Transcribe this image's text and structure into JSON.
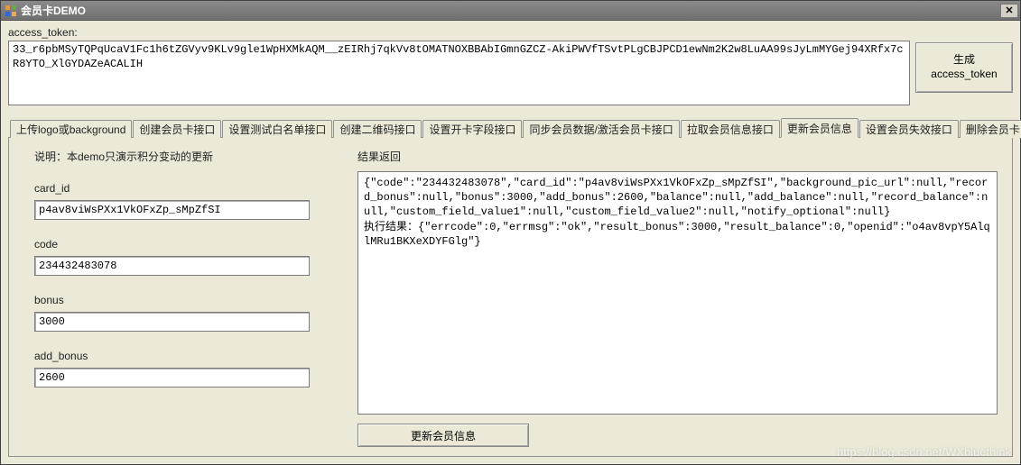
{
  "window": {
    "title": "会员卡DEMO"
  },
  "token": {
    "label": "access_token:",
    "value": "33_r6pbMSyTQPqUcaV1Fc1h6tZGVyv9KLv9gle1WpHXMkAQM__zEIRhj7qkVv8tOMATNOXBBAbIGmnGZCZ-AkiPWVfTSvtPLgCBJPCD1ewNm2K2w8LuAA99sJyLmMYGej94XRfx7cR8YTO_XlGYDAZeACALIH",
    "generate_label": "生成\naccess_token"
  },
  "tabs": {
    "items": [
      {
        "label": "上传logo或background"
      },
      {
        "label": "创建会员卡接口"
      },
      {
        "label": "设置测试白名单接口"
      },
      {
        "label": "创建二维码接口"
      },
      {
        "label": "设置开卡字段接口"
      },
      {
        "label": "同步会员数据/激活会员卡接口"
      },
      {
        "label": "拉取会员信息接口"
      },
      {
        "label": "更新会员信息"
      },
      {
        "label": "设置会员失效接口"
      },
      {
        "label": "删除会员卡"
      }
    ],
    "active_index": 7
  },
  "form": {
    "note": "说明：本demo只演示积分变动的更新",
    "fields": {
      "card_id": {
        "label": "card_id",
        "value": "p4av8viWsPXx1VkOFxZp_sMpZfSI"
      },
      "code": {
        "label": "code",
        "value": "234432483078"
      },
      "bonus": {
        "label": "bonus",
        "value": "3000"
      },
      "add_bonus": {
        "label": "add_bonus",
        "value": "2600"
      }
    }
  },
  "result": {
    "label": "结果返回",
    "text": "{\"code\":\"234432483078\",\"card_id\":\"p4av8viWsPXx1VkOFxZp_sMpZfSI\",\"background_pic_url\":null,\"record_bonus\":null,\"bonus\":3000,\"add_bonus\":2600,\"balance\":null,\"add_balance\":null,\"record_balance\":null,\"custom_field_value1\":null,\"custom_field_value2\":null,\"notify_optional\":null}\n执行结果：{\"errcode\":0,\"errmsg\":\"ok\",\"result_bonus\":3000,\"result_balance\":0,\"openid\":\"o4av8vpY5AlqlMRu1BKXeXDYFGlg\"}"
  },
  "buttons": {
    "update": "更新会员信息"
  },
  "watermark": "https://blog.csdn.net/WXbluethink"
}
